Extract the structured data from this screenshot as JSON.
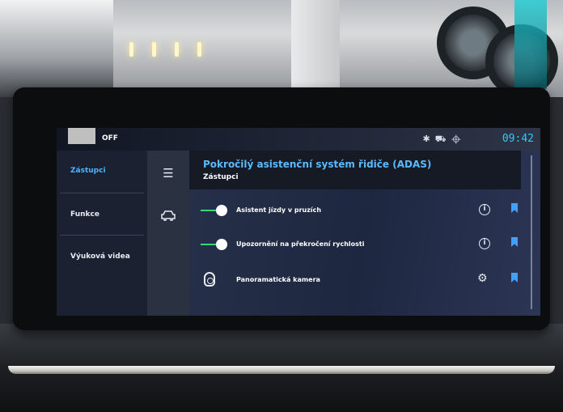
{
  "status_bar": {
    "mode_text": "OFF",
    "clock": "09:42",
    "icons": [
      "bluetooth-icon",
      "car-connect-icon",
      "location-icon"
    ]
  },
  "left_nav": {
    "items": [
      {
        "label": "Zástupci",
        "active": true
      },
      {
        "label": "Funkce",
        "active": false
      },
      {
        "label": "Výuková videa",
        "active": false
      }
    ]
  },
  "icon_rail": {
    "icons": [
      "menu-icon",
      "car-icon"
    ]
  },
  "header": {
    "title": "Pokročilý asistenční systém řidiče (ADAS)",
    "subtitle": "Zástupci"
  },
  "rows": [
    {
      "label": "Asistent jízdy v pruzích",
      "control": "toggle",
      "on": true,
      "action_icon": "info-icon",
      "bookmarked": true
    },
    {
      "label": "Upozornění na překročení rychlosti",
      "control": "toggle",
      "on": true,
      "action_icon": "info-icon",
      "bookmarked": true
    },
    {
      "label": "Panoramatická kamera",
      "control": "camera-icon",
      "action_icon": "settings-icon",
      "bookmarked": true
    }
  ],
  "colors": {
    "accent_blue": "#5ab9ff",
    "toggle_green": "#3cd37a",
    "clock_blue": "#2ec8ff"
  }
}
